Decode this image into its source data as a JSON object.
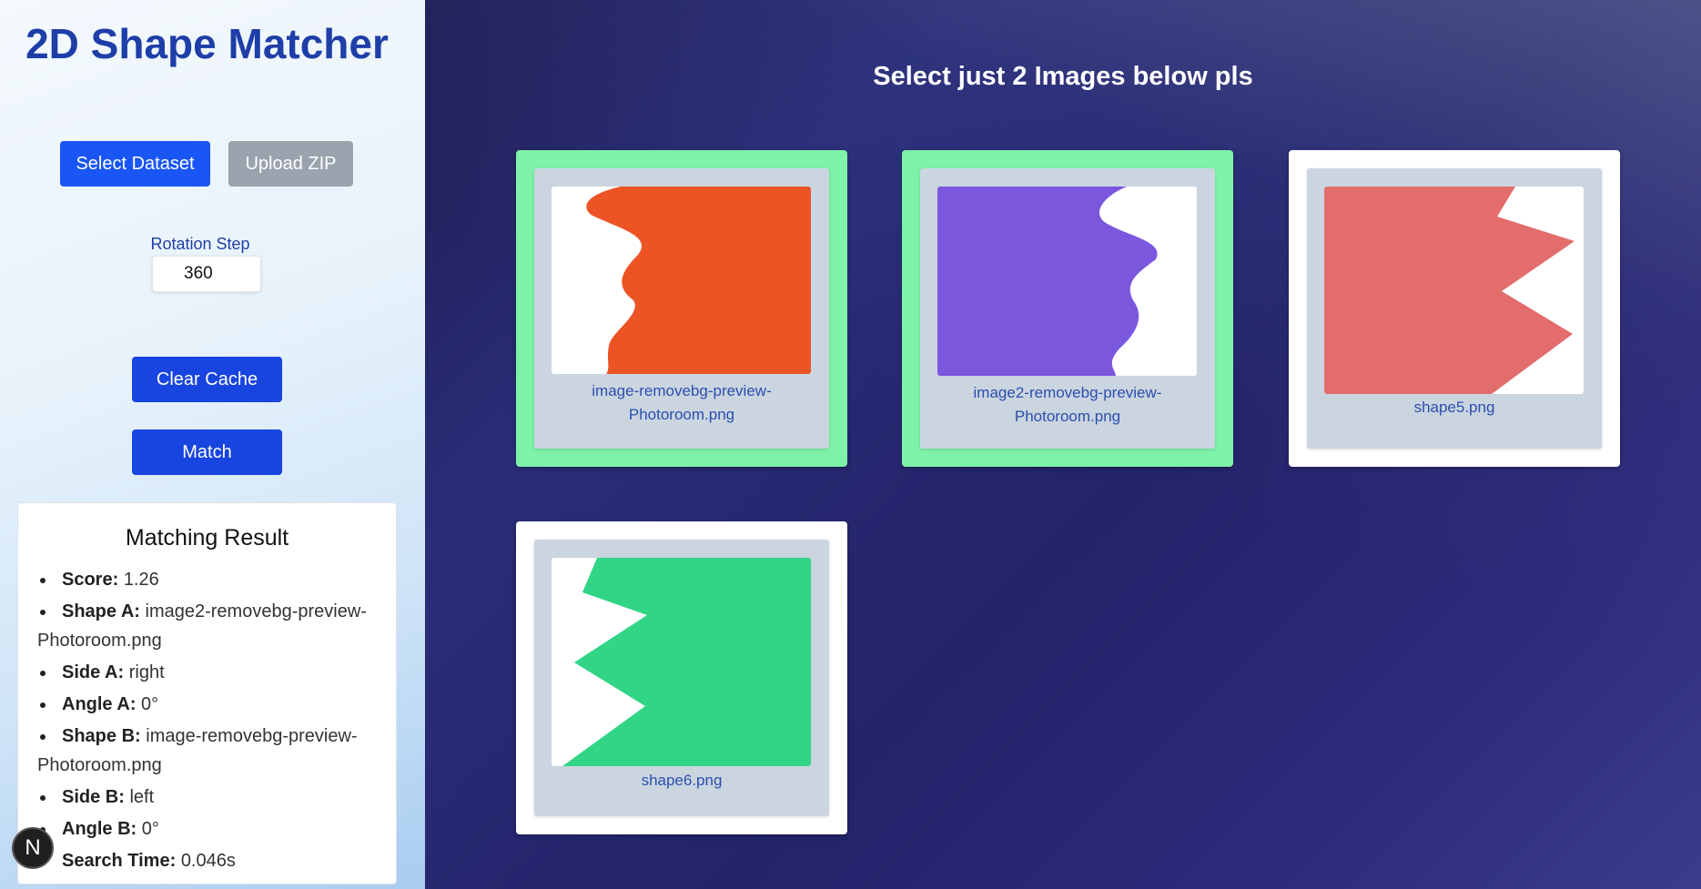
{
  "sidebar": {
    "title": "2D Shape Matcher",
    "select_dataset_label": "Select Dataset",
    "upload_zip_label": "Upload ZIP",
    "rotation_step_label": "Rotation Step",
    "rotation_step_value": "360",
    "clear_cache_label": "Clear Cache",
    "match_label": "Match",
    "nav_badge": "N"
  },
  "result": {
    "title": "Matching Result",
    "items": [
      {
        "key": "Score:",
        "value": "1.26"
      },
      {
        "key": "Shape A:",
        "value": "image2-removebg-preview-Photoroom.png"
      },
      {
        "key": "Side A:",
        "value": "right"
      },
      {
        "key": "Angle A:",
        "value": "0°"
      },
      {
        "key": "Shape B:",
        "value": "image-removebg-preview-Photoroom.png"
      },
      {
        "key": "Side B:",
        "value": "left"
      },
      {
        "key": "Angle B:",
        "value": "0°"
      },
      {
        "key": "Search Time:",
        "value": "0.046s"
      }
    ]
  },
  "main": {
    "heading": "Select just 2 Images below pls",
    "images": [
      {
        "name": "image-removebg-preview-Photoroom.png",
        "selected": true,
        "color": "#ec5325"
      },
      {
        "name": "image2-removebg-preview-Photoroom.png",
        "selected": true,
        "color": "#7b57de"
      },
      {
        "name": "shape5.png",
        "selected": false,
        "color": "#e36c6c"
      },
      {
        "name": "shape6.png",
        "selected": false,
        "color": "#31d585"
      }
    ]
  },
  "colors": {
    "accent_blue": "#1a56f5",
    "title_blue": "#1e3ea8",
    "selected_green": "#7ef2a8"
  }
}
